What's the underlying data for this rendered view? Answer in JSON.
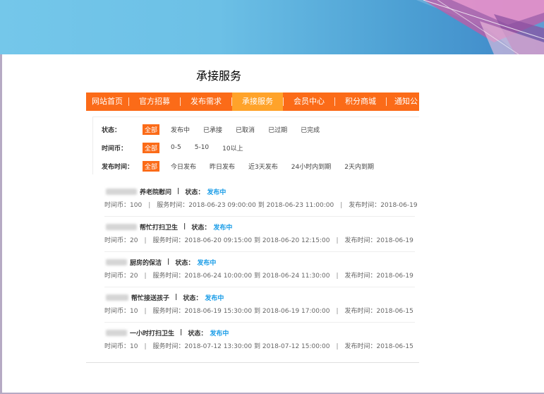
{
  "slide": {
    "title": "承接服务"
  },
  "nav": {
    "items": [
      {
        "label": "网站首页",
        "active": false
      },
      {
        "label": "官方招募",
        "active": false
      },
      {
        "label": "发布需求",
        "active": false
      },
      {
        "label": "承接服务",
        "active": true
      },
      {
        "label": "会员中心",
        "active": false
      },
      {
        "label": "积分商城",
        "active": false
      },
      {
        "label": "通知公",
        "active": false
      }
    ]
  },
  "filters": {
    "status": {
      "label": "状态：",
      "options": [
        "全部",
        "发布中",
        "已承接",
        "已取消",
        "已过期",
        "已完成"
      ]
    },
    "coins": {
      "label": "时间币：",
      "options": [
        "全部",
        "0-5",
        "5-10",
        "10以上"
      ]
    },
    "publish_time": {
      "label": "发布时间：",
      "options": [
        "全部",
        "今日发布",
        "昨日发布",
        "近3天发布",
        "24小时内到期",
        "2天内到期"
      ]
    }
  },
  "list": {
    "status_label": "状态：",
    "coin_label": "时间币：",
    "service_label": "服务时间：",
    "publish_label": "发布时间：",
    "to_word": "到",
    "items": [
      {
        "title": "养老院慰问",
        "status": "发布中",
        "coins": "100",
        "start": "2018-06-23 09:00:00",
        "end": "2018-06-23 11:00:00",
        "published": "2018-06-19"
      },
      {
        "title": "帮忙打扫卫生",
        "status": "发布中",
        "coins": "20",
        "start": "2018-06-20 09:15:00",
        "end": "2018-06-20 12:15:00",
        "published": "2018-06-19"
      },
      {
        "title": "厨房的保洁",
        "status": "发布中",
        "coins": "20",
        "start": "2018-06-24 10:00:00",
        "end": "2018-06-24 11:30:00",
        "published": "2018-06-19"
      },
      {
        "title": "帮忙接送孩子",
        "status": "发布中",
        "coins": "10",
        "start": "2018-06-19 15:30:00",
        "end": "2018-06-19 17:00:00",
        "published": "2018-06-15"
      },
      {
        "title": "一小时打扫卫生",
        "status": "发布中",
        "coins": "10",
        "start": "2018-07-12 13:30:00",
        "end": "2018-07-12 15:00:00",
        "published": "2018-06-15"
      }
    ]
  },
  "colors": {
    "nav_bg": "#fb6b18",
    "nav_active": "#ffa32a",
    "status_blue": "#199ce7"
  }
}
